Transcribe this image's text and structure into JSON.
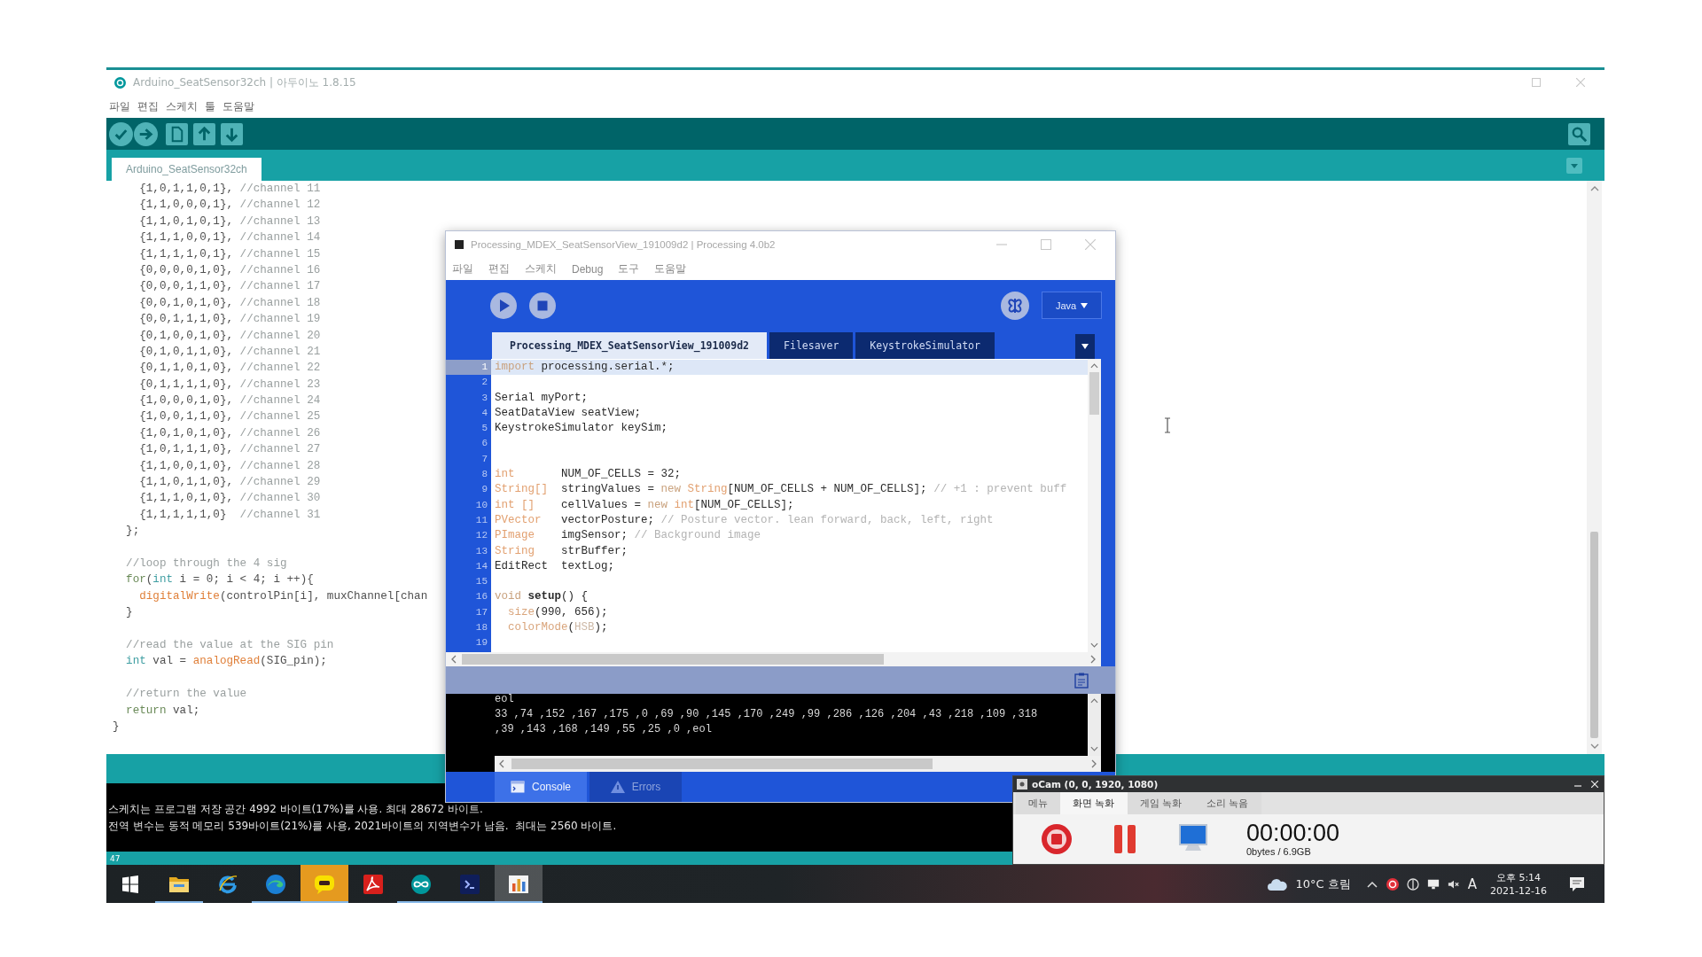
{
  "arduino": {
    "title": "Arduino_SeatSensor32ch | 아두이노 1.8.15",
    "menu": [
      "파일",
      "편집",
      "스케치",
      "툴",
      "도움말"
    ],
    "tabs": [
      {
        "label": "Arduino_SeatSensor32ch",
        "selected": true
      }
    ],
    "code_blocks": [
      {
        "lines": [
          [
            {
              "text": "    {1,0,1,1,0,1}, ",
              "kind": "plain"
            },
            {
              "text": "//channel 11",
              "kind": "comment"
            }
          ],
          [
            {
              "text": "    {1,1,0,0,0,1}, ",
              "kind": "plain"
            },
            {
              "text": "//channel 12",
              "kind": "comment"
            }
          ],
          [
            {
              "text": "    {1,1,0,1,0,1}, ",
              "kind": "plain"
            },
            {
              "text": "//channel 13",
              "kind": "comment"
            }
          ],
          [
            {
              "text": "    {1,1,1,0,0,1}, ",
              "kind": "plain"
            },
            {
              "text": "//channel 14",
              "kind": "comment"
            }
          ],
          [
            {
              "text": "    {1,1,1,1,0,1}, ",
              "kind": "plain"
            },
            {
              "text": "//channel 15",
              "kind": "comment"
            }
          ],
          [
            {
              "text": "    {0,0,0,0,1,0}, ",
              "kind": "plain"
            },
            {
              "text": "//channel 16",
              "kind": "comment"
            }
          ],
          [
            {
              "text": "    {0,0,0,1,1,0}, ",
              "kind": "plain"
            },
            {
              "text": "//channel 17",
              "kind": "comment"
            }
          ],
          [
            {
              "text": "    {0,0,1,0,1,0}, ",
              "kind": "plain"
            },
            {
              "text": "//channel 18",
              "kind": "comment"
            }
          ],
          [
            {
              "text": "    {0,0,1,1,1,0}, ",
              "kind": "plain"
            },
            {
              "text": "//channel 19",
              "kind": "comment"
            }
          ],
          [
            {
              "text": "    {0,1,0,0,1,0}, ",
              "kind": "plain"
            },
            {
              "text": "//channel 20",
              "kind": "comment"
            }
          ],
          [
            {
              "text": "    {0,1,0,1,1,0}, ",
              "kind": "plain"
            },
            {
              "text": "//channel 21",
              "kind": "comment"
            }
          ],
          [
            {
              "text": "    {0,1,1,0,1,0}, ",
              "kind": "plain"
            },
            {
              "text": "//channel 22",
              "kind": "comment"
            }
          ],
          [
            {
              "text": "    {0,1,1,1,1,0}, ",
              "kind": "plain"
            },
            {
              "text": "//channel 23",
              "kind": "comment"
            }
          ],
          [
            {
              "text": "    {1,0,0,0,1,0}, ",
              "kind": "plain"
            },
            {
              "text": "//channel 24",
              "kind": "comment"
            }
          ],
          [
            {
              "text": "    {1,0,0,1,1,0}, ",
              "kind": "plain"
            },
            {
              "text": "//channel 25",
              "kind": "comment"
            }
          ],
          [
            {
              "text": "    {1,0,1,0,1,0}, ",
              "kind": "plain"
            },
            {
              "text": "//channel 26",
              "kind": "comment"
            }
          ],
          [
            {
              "text": "    {1,0,1,1,1,0}, ",
              "kind": "plain"
            },
            {
              "text": "//channel 27",
              "kind": "comment"
            }
          ],
          [
            {
              "text": "    {1,1,0,0,1,0}, ",
              "kind": "plain"
            },
            {
              "text": "//channel 28",
              "kind": "comment"
            }
          ],
          [
            {
              "text": "    {1,1,0,1,1,0}, ",
              "kind": "plain"
            },
            {
              "text": "//channel 29",
              "kind": "comment"
            }
          ],
          [
            {
              "text": "    {1,1,1,0,1,0}, ",
              "kind": "plain"
            },
            {
              "text": "//channel 30",
              "kind": "comment"
            }
          ],
          [
            {
              "text": "    {1,1,1,1,1,0}  ",
              "kind": "plain"
            },
            {
              "text": "//channel 31",
              "kind": "comment"
            }
          ],
          [
            {
              "text": "  };",
              "kind": "plain"
            }
          ]
        ]
      },
      {
        "lines": [
          [
            {
              "text": "  //loop through the 4 sig",
              "kind": "comment"
            }
          ],
          [
            {
              "text": "  for",
              "kind": "keyword"
            },
            {
              "text": "(",
              "kind": "plain"
            },
            {
              "text": "int",
              "kind": "type"
            },
            {
              "text": " i = 0; i < 4; i ++){",
              "kind": "plain"
            }
          ],
          [
            {
              "text": "    digitalWrite",
              "kind": "function"
            },
            {
              "text": "(controlPin[i], muxChannel[chan",
              "kind": "plain"
            }
          ],
          [
            {
              "text": "  }",
              "kind": "plain"
            }
          ]
        ]
      },
      {
        "lines": [
          [
            {
              "text": "  //read the value at the SIG pin",
              "kind": "comment"
            }
          ],
          [
            {
              "text": "  int",
              "kind": "type"
            },
            {
              "text": " val = ",
              "kind": "plain"
            },
            {
              "text": "analogRead",
              "kind": "function"
            },
            {
              "text": "(SIG_pin);",
              "kind": "plain"
            }
          ]
        ]
      },
      {
        "lines": [
          [
            {
              "text": "  //return the value",
              "kind": "comment"
            }
          ],
          [
            {
              "text": "  return",
              "kind": "keyword"
            },
            {
              "text": " val;",
              "kind": "plain"
            }
          ],
          [
            {
              "text": "}",
              "kind": "plain"
            }
          ]
        ]
      }
    ],
    "console_lines": [
      "스케치는 프로그램 저장 공간 4992 바이트(17%)를 사용. 최대 28672 바이트.",
      "전역 변수는 동적 메모리 539바이트(21%)를 사용, 2021바이트의 지역변수가 남음.  최대는 2560 바이트."
    ],
    "line_indicator": "47"
  },
  "processing": {
    "title": "Processing_MDEX_SeatSensorView_191009d2 | Processing 4.0b2",
    "menu": [
      "파일",
      "편집",
      "스케치",
      "Debug",
      "도구",
      "도움말"
    ],
    "mode": "Java",
    "tabs": [
      {
        "label": "Processing_MDEX_SeatSensorView_191009d2",
        "selected": true
      },
      {
        "label": "Filesaver",
        "selected": false
      },
      {
        "label": "KeystrokeSimulator",
        "selected": false
      }
    ],
    "code_lines": [
      {
        "number": "1",
        "highlighted": true,
        "segments": [
          {
            "text": "import",
            "kind": "keyword"
          },
          {
            "text": " processing.serial.*;",
            "kind": "plain"
          }
        ]
      },
      {
        "number": "2",
        "highlighted": false
      },
      {
        "number": "3",
        "highlighted": false,
        "segments": [
          {
            "text": "Serial myPort;",
            "kind": "plain"
          }
        ]
      },
      {
        "number": "4",
        "highlighted": false,
        "segments": [
          {
            "text": "SeatDataView seatView;",
            "kind": "plain"
          }
        ]
      },
      {
        "number": "5",
        "highlighted": false,
        "segments": [
          {
            "text": "KeystrokeSimulator keySim;",
            "kind": "plain"
          }
        ]
      },
      {
        "number": "6",
        "highlighted": false
      },
      {
        "number": "7",
        "highlighted": false
      },
      {
        "number": "8",
        "highlighted": false,
        "segments": [
          {
            "text": "int",
            "kind": "type"
          },
          {
            "text": "       NUM_OF_CELLS = 32;",
            "kind": "plain"
          }
        ]
      },
      {
        "number": "9",
        "highlighted": false,
        "segments": [
          {
            "text": "String[]",
            "kind": "type"
          },
          {
            "text": "  stringValues = ",
            "kind": "plain"
          },
          {
            "text": "new",
            "kind": "keyword"
          },
          {
            "text": " String",
            "kind": "type"
          },
          {
            "text": "[NUM_OF_CELLS + NUM_OF_CELLS]; ",
            "kind": "plain"
          },
          {
            "text": "// +1 : prevent buff",
            "kind": "comment"
          }
        ]
      },
      {
        "number": "10",
        "highlighted": false,
        "segments": [
          {
            "text": "int []",
            "kind": "type"
          },
          {
            "text": "    cellValues = ",
            "kind": "plain"
          },
          {
            "text": "new",
            "kind": "keyword"
          },
          {
            "text": " int",
            "kind": "type"
          },
          {
            "text": "[NUM_OF_CELLS];",
            "kind": "plain"
          }
        ]
      },
      {
        "number": "11",
        "highlighted": false,
        "segments": [
          {
            "text": "PVector",
            "kind": "type"
          },
          {
            "text": "   vectorPosture; ",
            "kind": "plain"
          },
          {
            "text": "// Posture vector. lean forward, back, left, right",
            "kind": "comment"
          }
        ]
      },
      {
        "number": "12",
        "highlighted": false,
        "segments": [
          {
            "text": "PImage",
            "kind": "type"
          },
          {
            "text": "    imgSensor; ",
            "kind": "plain"
          },
          {
            "text": "// Background image",
            "kind": "comment"
          }
        ]
      },
      {
        "number": "13",
        "highlighted": false,
        "segments": [
          {
            "text": "String",
            "kind": "type"
          },
          {
            "text": "    strBuffer;",
            "kind": "plain"
          }
        ]
      },
      {
        "number": "14",
        "highlighted": false,
        "segments": [
          {
            "text": "EditRect  textLog;",
            "kind": "plain"
          }
        ]
      },
      {
        "number": "15",
        "highlighted": false
      },
      {
        "number": "16",
        "highlighted": false,
        "segments": [
          {
            "text": "void",
            "kind": "keyword"
          },
          {
            "text": " setup",
            "kind": "definition"
          },
          {
            "text": "() {",
            "kind": "plain"
          }
        ]
      },
      {
        "number": "17",
        "highlighted": false,
        "segments": [
          {
            "text": "  size",
            "kind": "function"
          },
          {
            "text": "(990, 656);",
            "kind": "plain"
          }
        ]
      },
      {
        "number": "18",
        "highlighted": false,
        "segments": [
          {
            "text": "  colorMode",
            "kind": "function"
          },
          {
            "text": "(",
            "kind": "plain"
          },
          {
            "text": "HSB",
            "kind": "constant"
          },
          {
            "text": ");",
            "kind": "plain"
          }
        ]
      },
      {
        "number": "19",
        "highlighted": false
      }
    ],
    "console_lines": [
      "eol",
      "33 ,74 ,152 ,167 ,175 ,0 ,69 ,90 ,145 ,170 ,249 ,99 ,286 ,126 ,204 ,43 ,218 ,109 ,318",
      ",39 ,143 ,168 ,149 ,55 ,25 ,0 ,eol"
    ],
    "console_tabs": [
      {
        "kind": "console",
        "label": "Console",
        "selected": true
      },
      {
        "kind": "errors",
        "label": "Errors",
        "selected": false
      }
    ]
  },
  "ocam": {
    "title": "oCam (0, 0, 1920, 1080)",
    "tabs": [
      {
        "label": "메뉴",
        "selected": false
      },
      {
        "label": "화면 녹화",
        "selected": true
      },
      {
        "label": "게임 녹화",
        "selected": false
      },
      {
        "label": "소리 녹음",
        "selected": false
      }
    ],
    "timer": "00:00:00",
    "storage": "0bytes / 6.9GB"
  },
  "taskbar": {
    "apps": [
      {
        "kind": "start",
        "running": false,
        "selected": false,
        "attention": false
      },
      {
        "kind": "folder",
        "running": true,
        "selected": false,
        "attention": false
      },
      {
        "kind": "ie",
        "running": false,
        "selected": false,
        "attention": false
      },
      {
        "kind": "edge",
        "running": true,
        "selected": false,
        "attention": false
      },
      {
        "kind": "chat",
        "running": true,
        "selected": false,
        "attention": true
      },
      {
        "kind": "pdf",
        "running": false,
        "selected": false,
        "attention": false
      },
      {
        "kind": "arduino",
        "running": true,
        "selected": false,
        "attention": false
      },
      {
        "kind": "processing",
        "running": true,
        "selected": false,
        "attention": false
      },
      {
        "kind": "chart",
        "running": true,
        "selected": true,
        "attention": false
      }
    ],
    "weather": "10°C 흐림",
    "input_mode": "A",
    "time": "오후 5:14",
    "date": "2021-12-16"
  }
}
